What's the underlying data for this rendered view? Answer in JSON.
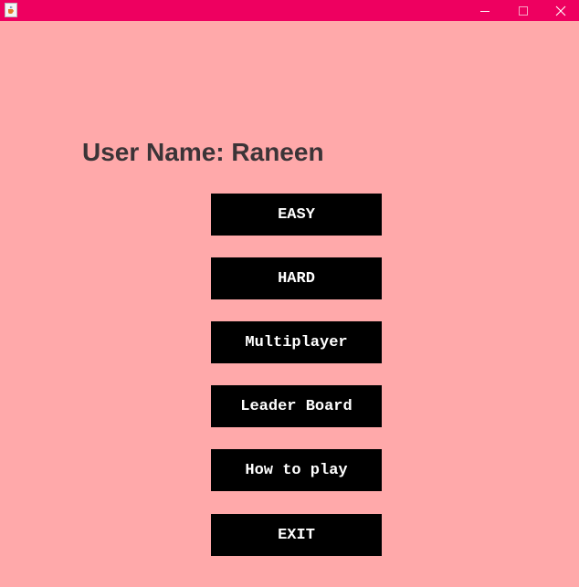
{
  "window": {
    "background_color": "#ffa9aa",
    "titlebar_color": "#ee0060",
    "app_icon": "java-cup-icon",
    "controls": {
      "minimize_icon": "minimize-icon",
      "maximize_icon": "maximize-icon",
      "close_icon": "close-icon"
    }
  },
  "main": {
    "username_text": "User Name: Raneen",
    "buttons": [
      {
        "label": "EASY"
      },
      {
        "label": "HARD"
      },
      {
        "label": "Multiplayer"
      },
      {
        "label": "Leader Board"
      },
      {
        "label": "How to play"
      },
      {
        "label": "EXIT"
      }
    ]
  }
}
